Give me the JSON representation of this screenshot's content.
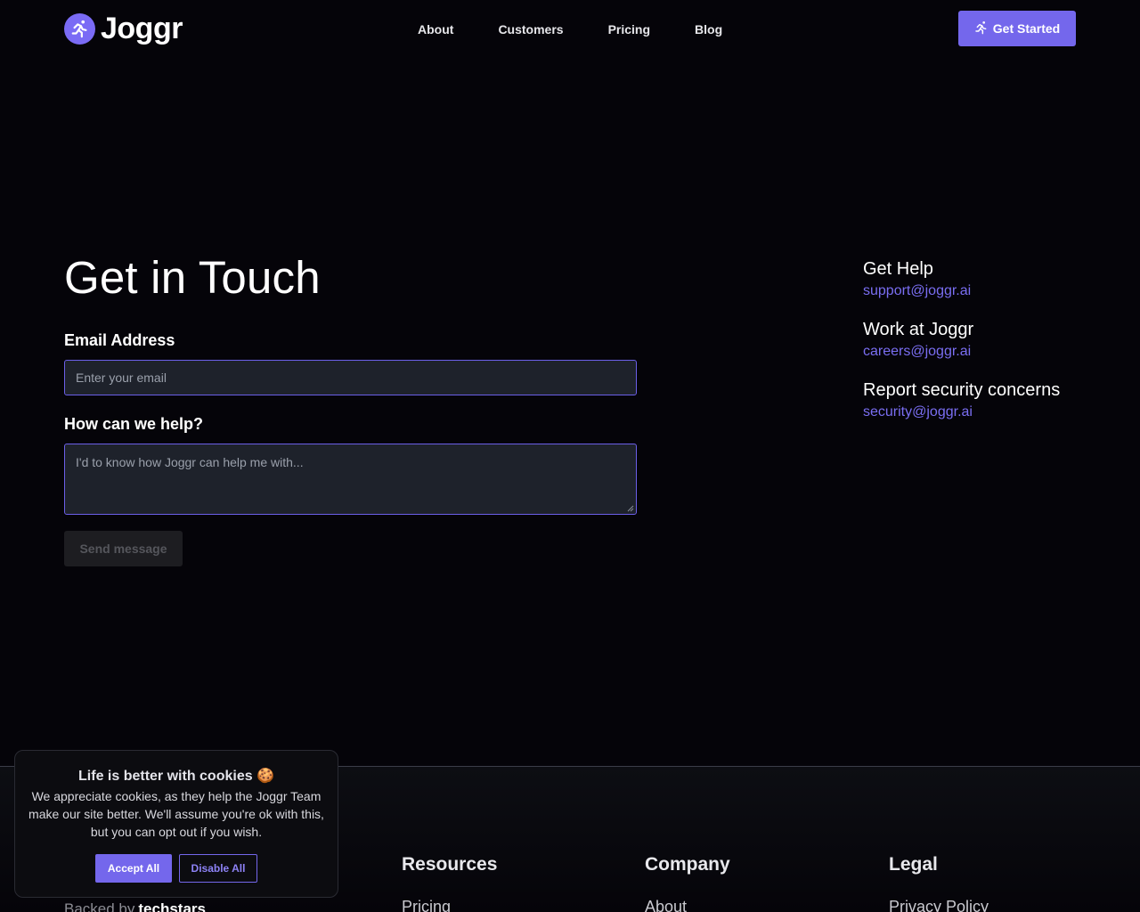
{
  "brand": {
    "name": "Joggr",
    "accent": "#7467ec"
  },
  "nav": {
    "items": [
      "About",
      "Customers",
      "Pricing",
      "Blog"
    ]
  },
  "cta": {
    "label": "Get Started",
    "icon": "running-person-icon"
  },
  "form": {
    "title": "Get in Touch",
    "email_label": "Email Address",
    "email_placeholder": "Enter your email",
    "help_label": "How can we help?",
    "help_placeholder": "I'd to know how Joggr can help me with...",
    "send_label": "Send message"
  },
  "contacts": [
    {
      "title": "Get Help",
      "email": "support@joggr.ai"
    },
    {
      "title": "Work at Joggr",
      "email": "careers@joggr.ai"
    },
    {
      "title": "Report security concerns",
      "email": "security@joggr.ai"
    }
  ],
  "footer": {
    "backed_by": "Backed by",
    "backer": "techstars",
    "columns": [
      {
        "heading": "Resources",
        "first_link": "Pricing"
      },
      {
        "heading": "Company",
        "first_link": "About"
      },
      {
        "heading": "Legal",
        "first_link": "Privacy Policy"
      }
    ]
  },
  "cookie": {
    "title": "Life is better with cookies 🍪",
    "body": "We appreciate cookies, as they help the Joggr Team make our site better. We'll assume you're ok with this, but you can opt out if you wish.",
    "accept": "Accept All",
    "disable": "Disable All"
  }
}
